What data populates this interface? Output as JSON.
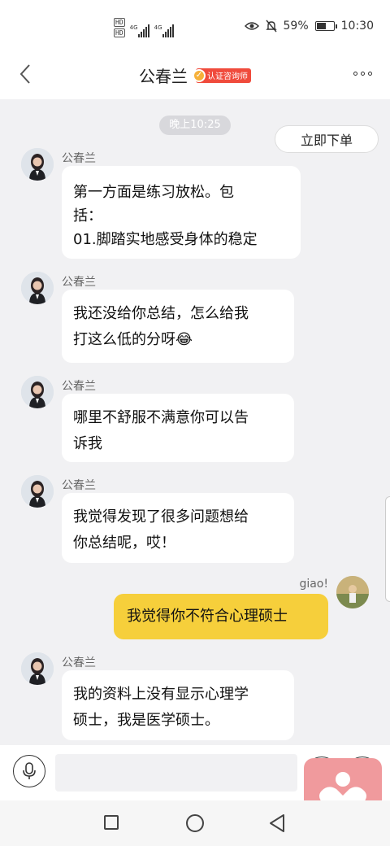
{
  "status_bar": {
    "hd1": "HD",
    "hd2": "HD",
    "net1": "4G",
    "net2": "4G",
    "battery_text": "59%",
    "battery_level": 0.59,
    "time": "10:30"
  },
  "header": {
    "title": "公春兰",
    "badge": "认证咨询师"
  },
  "chat": {
    "timestamp": "晚上10:25",
    "order_button": "立即下单",
    "messages": [
      {
        "sender": "公春兰",
        "side": "left",
        "lines": [
          "第一方面是练习放松。包",
          "括：",
          "01.脚踏实地感受身体的稳定"
        ]
      },
      {
        "sender": "公春兰",
        "side": "left",
        "lines": [
          "我还没给你总结，怎么给我",
          "打这么低的分呀😂"
        ]
      },
      {
        "sender": "公春兰",
        "side": "left",
        "lines": [
          "哪里不舒服不满意你可以告",
          "诉我"
        ]
      },
      {
        "sender": "公春兰",
        "side": "left",
        "lines": [
          "我觉得发现了很多问题想给",
          "你总结呢，哎！"
        ]
      },
      {
        "sender": "giao!",
        "side": "right",
        "lines": [
          "我觉得你不符合心理硕士"
        ]
      },
      {
        "sender": "公春兰",
        "side": "left",
        "lines": [
          "我的资料上没有显示心理学",
          "硕士，我是医学硕士。"
        ]
      }
    ]
  },
  "input": {
    "value": "",
    "placeholder": ""
  },
  "colors": {
    "accent": "#f6cf3b",
    "badge": "#f04b3c",
    "chat_bg": "#f1f1f3"
  }
}
